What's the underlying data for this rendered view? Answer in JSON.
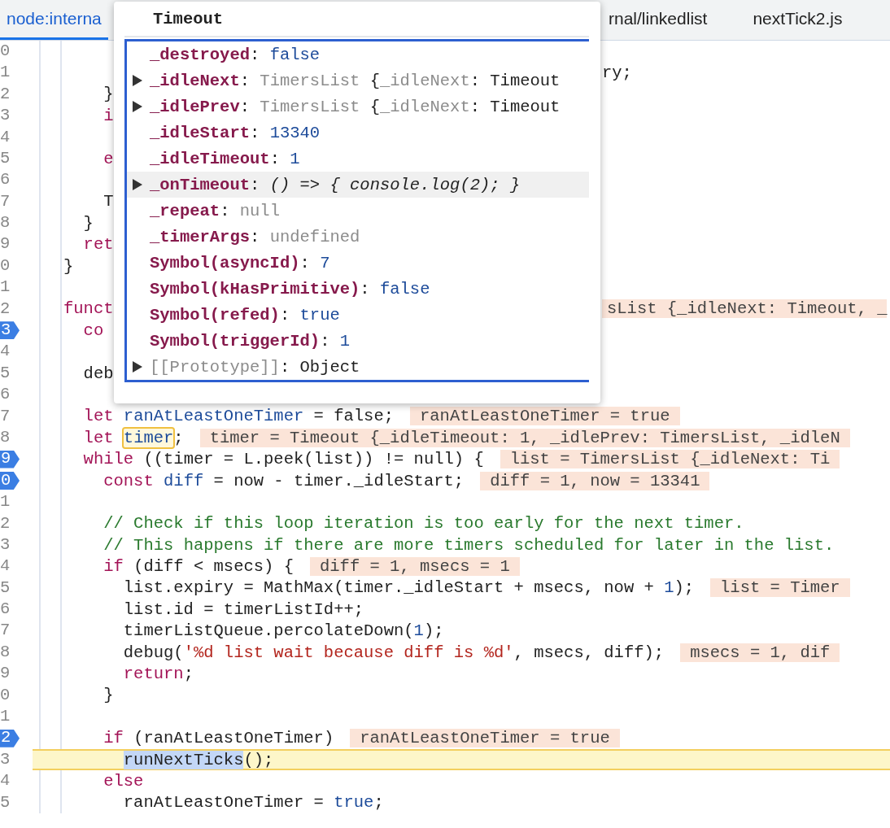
{
  "tabs": [
    {
      "label": "node:interna",
      "selected": true
    },
    {
      "label": "rnal/linkedlist",
      "selected": false
    },
    {
      "label": "nextTick2.js",
      "selected": false
    }
  ],
  "lines": [
    {
      "number": "0",
      "breakpoint": false,
      "current": false
    },
    {
      "number": "1",
      "breakpoint": false,
      "current": false,
      "far_code": [
        {
          "kind": "plain",
          "text": "ry;"
        }
      ]
    },
    {
      "number": "2",
      "breakpoint": false,
      "current": false,
      "code": [
        {
          "kind": "plain",
          "text": "    }"
        }
      ]
    },
    {
      "number": "3",
      "breakpoint": false,
      "current": false,
      "code": [
        {
          "kind": "kw",
          "text": "    i"
        }
      ]
    },
    {
      "number": "4",
      "breakpoint": false,
      "current": false
    },
    {
      "number": "5",
      "breakpoint": false,
      "current": false,
      "code": [
        {
          "kind": "kw",
          "text": "    e"
        }
      ]
    },
    {
      "number": "6",
      "breakpoint": false,
      "current": false
    },
    {
      "number": "7",
      "breakpoint": false,
      "current": false,
      "code": [
        {
          "kind": "plain",
          "text": "    T"
        }
      ]
    },
    {
      "number": "8",
      "breakpoint": false,
      "current": false,
      "code": [
        {
          "kind": "plain",
          "text": "  }"
        }
      ]
    },
    {
      "number": "9",
      "breakpoint": false,
      "current": false,
      "code": [
        {
          "kind": "kw",
          "text": "  ret"
        }
      ]
    },
    {
      "number": "0",
      "breakpoint": false,
      "current": false,
      "code": [
        {
          "kind": "plain",
          "text": "}"
        }
      ]
    },
    {
      "number": "1",
      "breakpoint": false,
      "current": false
    },
    {
      "number": "2",
      "breakpoint": false,
      "current": false,
      "code": [
        {
          "kind": "kw",
          "text": "funct"
        }
      ],
      "far_value": "sList {_idleNext: Timeout, _"
    },
    {
      "number": "3",
      "breakpoint": true,
      "current": false,
      "code": [
        {
          "kind": "kw",
          "text": "  co"
        }
      ]
    },
    {
      "number": "4",
      "breakpoint": false,
      "current": false
    },
    {
      "number": "5",
      "breakpoint": false,
      "current": false,
      "code": [
        {
          "kind": "plain",
          "text": "  deb"
        }
      ]
    },
    {
      "number": "6",
      "breakpoint": false,
      "current": false
    },
    {
      "number": "7",
      "breakpoint": false,
      "current": false,
      "code": [
        {
          "kind": "kw",
          "text": "  let "
        },
        {
          "kind": "def",
          "text": "ranAtLeastOneTimer"
        },
        {
          "kind": "plain",
          "text": " = false;"
        }
      ],
      "value": "ranAtLeastOneTimer = true"
    },
    {
      "number": "8",
      "breakpoint": false,
      "current": false,
      "code": [
        {
          "kind": "kw",
          "text": "  let "
        },
        {
          "kind": "hl",
          "text": "timer"
        },
        {
          "kind": "plain",
          "text": ";"
        }
      ],
      "value": "timer = Timeout {_idleTimeout: 1, _idlePrev: TimersList, _idleN"
    },
    {
      "number": "9",
      "breakpoint": true,
      "current": false,
      "code": [
        {
          "kind": "kw",
          "text": "  while"
        },
        {
          "kind": "plain",
          "text": " ((timer = L.peek(list)) != null) {"
        }
      ],
      "value": "list = TimersList {_idleNext: Ti"
    },
    {
      "number": "0",
      "breakpoint": true,
      "current": false,
      "code": [
        {
          "kind": "kw",
          "text": "    const "
        },
        {
          "kind": "def",
          "text": "diff"
        },
        {
          "kind": "plain",
          "text": " = now - timer._idleStart;"
        }
      ],
      "value": "diff = 1, now = 13341"
    },
    {
      "number": "1",
      "breakpoint": false,
      "current": false
    },
    {
      "number": "2",
      "breakpoint": false,
      "current": false,
      "code": [
        {
          "kind": "com",
          "text": "    // Check if this loop iteration is too early for the next timer."
        }
      ]
    },
    {
      "number": "3",
      "breakpoint": false,
      "current": false,
      "code": [
        {
          "kind": "com",
          "text": "    // This happens if there are more timers scheduled for later in the list."
        }
      ]
    },
    {
      "number": "4",
      "breakpoint": false,
      "current": false,
      "code": [
        {
          "kind": "kw",
          "text": "    if"
        },
        {
          "kind": "plain",
          "text": " (diff < msecs) {"
        }
      ],
      "value": "diff = 1, msecs = 1"
    },
    {
      "number": "5",
      "breakpoint": false,
      "current": false,
      "code": [
        {
          "kind": "plain",
          "text": "      list.expiry = MathMax(timer._idleStart + msecs, now + "
        },
        {
          "kind": "num",
          "text": "1"
        },
        {
          "kind": "plain",
          "text": ");"
        }
      ],
      "value": "list = Timer"
    },
    {
      "number": "6",
      "breakpoint": false,
      "current": false,
      "code": [
        {
          "kind": "plain",
          "text": "      list.id = timerListId++;"
        }
      ]
    },
    {
      "number": "7",
      "breakpoint": false,
      "current": false,
      "code": [
        {
          "kind": "plain",
          "text": "      timerListQueue.percolateDown("
        },
        {
          "kind": "num",
          "text": "1"
        },
        {
          "kind": "plain",
          "text": ");"
        }
      ]
    },
    {
      "number": "8",
      "breakpoint": false,
      "current": false,
      "code": [
        {
          "kind": "plain",
          "text": "      debug("
        },
        {
          "kind": "str",
          "text": "'%d list wait because diff is %d'"
        },
        {
          "kind": "plain",
          "text": ", msecs, diff);"
        }
      ],
      "value": "msecs = 1, dif"
    },
    {
      "number": "9",
      "breakpoint": false,
      "current": false,
      "code": [
        {
          "kind": "kw",
          "text": "      return"
        },
        {
          "kind": "plain",
          "text": ";"
        }
      ]
    },
    {
      "number": "0",
      "breakpoint": false,
      "current": false,
      "code": [
        {
          "kind": "plain",
          "text": "    }"
        }
      ]
    },
    {
      "number": "1",
      "breakpoint": false,
      "current": false
    },
    {
      "number": "2",
      "breakpoint": true,
      "current": false,
      "code": [
        {
          "kind": "kw",
          "text": "    if"
        },
        {
          "kind": "plain",
          "text": " (ranAtLeastOneTimer)"
        }
      ],
      "value": "ranAtLeastOneTimer = true"
    },
    {
      "number": "3",
      "breakpoint": false,
      "current": true,
      "code": [
        {
          "kind": "sel",
          "text": "      runNextTicks"
        },
        {
          "kind": "plain",
          "text": "();"
        }
      ]
    },
    {
      "number": "4",
      "breakpoint": false,
      "current": false,
      "code": [
        {
          "kind": "kw",
          "text": "    else"
        }
      ]
    },
    {
      "number": "5",
      "breakpoint": false,
      "current": false,
      "code": [
        {
          "kind": "plain",
          "text": "      ranAtLeastOneTimer = "
        },
        {
          "kind": "num",
          "text": "true"
        },
        {
          "kind": "plain",
          "text": ";"
        }
      ]
    }
  ],
  "popover": {
    "title": "Timeout",
    "properties": [
      {
        "key": "_destroyed",
        "kind": "own",
        "expandable": false,
        "selected": false,
        "value": [
          {
            "kind": "plain",
            "text": ": "
          },
          {
            "kind": "lit",
            "text": "false"
          }
        ]
      },
      {
        "key": "_idleNext",
        "kind": "own",
        "expandable": true,
        "selected": false,
        "value": [
          {
            "kind": "plain",
            "text": ": "
          },
          {
            "kind": "muted",
            "text": "TimersList"
          },
          {
            "kind": "plain",
            "text": " {"
          },
          {
            "kind": "muted",
            "text": "_idleNext"
          },
          {
            "kind": "plain",
            "text": ": Timeout"
          }
        ]
      },
      {
        "key": "_idlePrev",
        "kind": "own",
        "expandable": true,
        "selected": false,
        "value": [
          {
            "kind": "plain",
            "text": ": "
          },
          {
            "kind": "muted",
            "text": "TimersList"
          },
          {
            "kind": "plain",
            "text": " {"
          },
          {
            "kind": "muted",
            "text": "_idleNext"
          },
          {
            "kind": "plain",
            "text": ": Timeout"
          }
        ]
      },
      {
        "key": "_idleStart",
        "kind": "own",
        "expandable": false,
        "selected": false,
        "value": [
          {
            "kind": "plain",
            "text": ": "
          },
          {
            "kind": "lit",
            "text": "13340"
          }
        ]
      },
      {
        "key": "_idleTimeout",
        "kind": "own",
        "expandable": false,
        "selected": false,
        "value": [
          {
            "kind": "plain",
            "text": ": "
          },
          {
            "kind": "lit",
            "text": "1"
          }
        ]
      },
      {
        "key": "_onTimeout",
        "kind": "own",
        "expandable": true,
        "selected": true,
        "value": [
          {
            "kind": "plain",
            "text": ": "
          },
          {
            "kind": "fn",
            "text": "() => { console.log(2); }"
          }
        ]
      },
      {
        "key": "_repeat",
        "kind": "own",
        "expandable": false,
        "selected": false,
        "value": [
          {
            "kind": "plain",
            "text": ": "
          },
          {
            "kind": "muted",
            "text": "null"
          }
        ]
      },
      {
        "key": "_timerArgs",
        "kind": "own",
        "expandable": false,
        "selected": false,
        "value": [
          {
            "kind": "plain",
            "text": ": "
          },
          {
            "kind": "muted",
            "text": "undefined"
          }
        ]
      },
      {
        "key": "Symbol(asyncId)",
        "kind": "own",
        "expandable": false,
        "selected": false,
        "value": [
          {
            "kind": "plain",
            "text": ": "
          },
          {
            "kind": "lit",
            "text": "7"
          }
        ]
      },
      {
        "key": "Symbol(kHasPrimitive)",
        "kind": "own",
        "expandable": false,
        "selected": false,
        "value": [
          {
            "kind": "plain",
            "text": ": "
          },
          {
            "kind": "lit",
            "text": "false"
          }
        ]
      },
      {
        "key": "Symbol(refed)",
        "kind": "own",
        "expandable": false,
        "selected": false,
        "value": [
          {
            "kind": "plain",
            "text": ": "
          },
          {
            "kind": "lit",
            "text": "true"
          }
        ]
      },
      {
        "key": "Symbol(triggerId)",
        "kind": "own",
        "expandable": false,
        "selected": false,
        "value": [
          {
            "kind": "plain",
            "text": ": "
          },
          {
            "kind": "lit",
            "text": "1"
          }
        ]
      },
      {
        "key": "[[Prototype]]",
        "kind": "internal",
        "expandable": true,
        "selected": false,
        "value": [
          {
            "kind": "plain",
            "text": ": Object"
          }
        ]
      }
    ]
  }
}
